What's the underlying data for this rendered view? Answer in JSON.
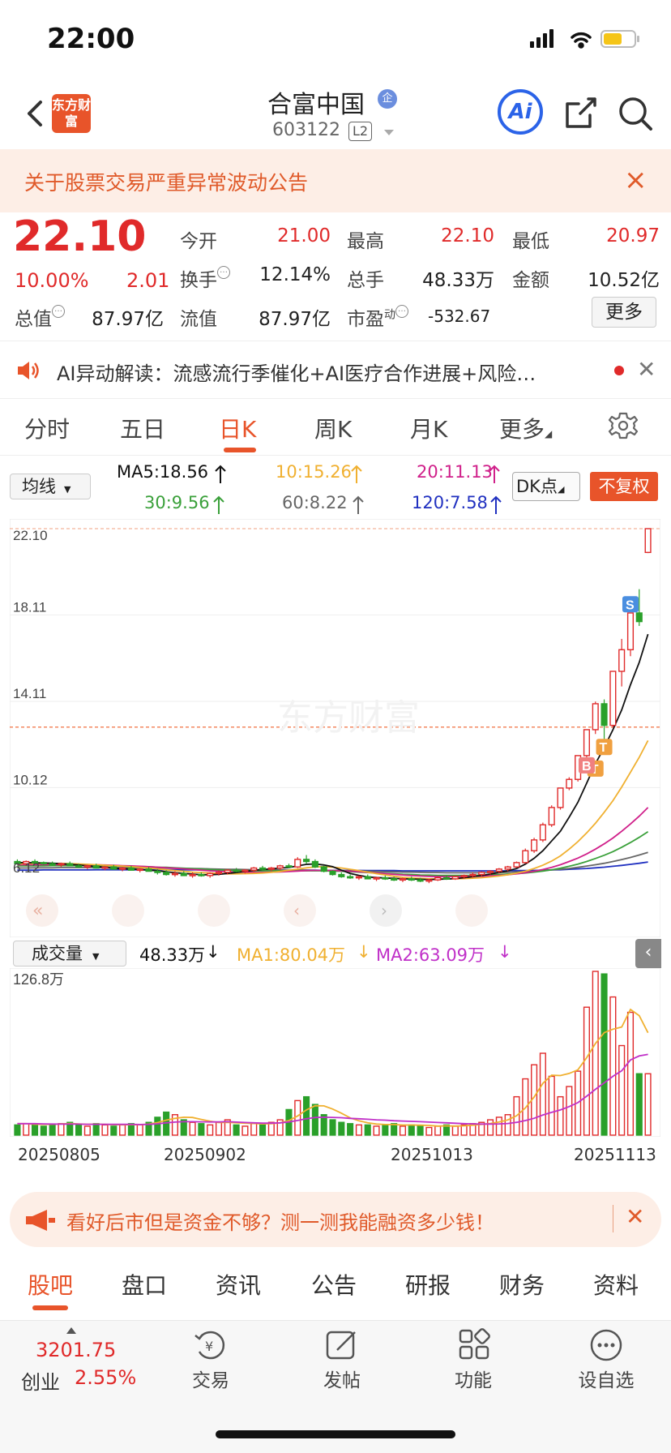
{
  "status": {
    "time": "22:00"
  },
  "header": {
    "logo_text": "东方财富",
    "name": "合富中国",
    "badge": "企",
    "code": "603122",
    "level": "L2",
    "ai_label": "Ai"
  },
  "notice": {
    "text": "关于股票交易严重异常波动公告"
  },
  "quote": {
    "price": "22.10",
    "pct": "10.00%",
    "chg": "2.01",
    "labels": {
      "open": "今开",
      "high": "最高",
      "low": "最低",
      "turnover": "换手",
      "volume": "总手",
      "amount": "金额",
      "total_cap": "总值",
      "float_cap": "流值",
      "pe": "市盈",
      "pe_sup": "动"
    },
    "open": "21.00",
    "high": "22.10",
    "low": "20.97",
    "turnover": "12.14%",
    "volume": "48.33万",
    "amount": "10.52亿",
    "total_cap": "87.97亿",
    "float_cap": "87.97亿",
    "pe": "-532.67",
    "more": "更多"
  },
  "ai_bar": {
    "text": "AI异动解读：流感流行季催化+AI医疗合作进展+风险…"
  },
  "tabs": [
    "分时",
    "五日",
    "日K",
    "周K",
    "月K",
    "更多"
  ],
  "active_tab": "日K",
  "ma": {
    "select": "均线",
    "ma5": "MA5:18.56",
    "ma10": "10:15.26",
    "ma20": "20:11.13",
    "ma30": "30:9.56",
    "ma60": "60:8.22",
    "ma120": "120:7.58",
    "dk": "DK点",
    "fq": "不复权"
  },
  "colors": {
    "up": "#e02a2a",
    "down": "#2aa02a",
    "ma5": "#111111",
    "ma10": "#f0b030",
    "ma20": "#d0208a",
    "ma30": "#3aa03a",
    "ma60": "#666666",
    "ma120": "#2030c0",
    "accent": "#e8542a"
  },
  "chart_data": {
    "type": "candlestick",
    "y_labels": [
      "22.10",
      "18.11",
      "14.11",
      "10.12",
      "6.12"
    ],
    "ylim": [
      6.12,
      22.1
    ],
    "watermark": "东方财富",
    "markers": [
      "S",
      "T",
      "T",
      "B"
    ],
    "candles": [
      [
        6.7,
        6.8,
        6.55,
        6.6
      ],
      [
        6.6,
        6.75,
        6.5,
        6.7
      ],
      [
        6.7,
        6.8,
        6.6,
        6.65
      ],
      [
        6.65,
        6.7,
        6.55,
        6.6
      ],
      [
        6.6,
        6.7,
        6.5,
        6.55
      ],
      [
        6.55,
        6.65,
        6.45,
        6.6
      ],
      [
        6.6,
        6.7,
        6.5,
        6.5
      ],
      [
        6.5,
        6.6,
        6.4,
        6.45
      ],
      [
        6.45,
        6.55,
        6.35,
        6.5
      ],
      [
        6.5,
        6.6,
        6.4,
        6.4
      ],
      [
        6.4,
        6.5,
        6.3,
        6.45
      ],
      [
        6.45,
        6.55,
        6.35,
        6.35
      ],
      [
        6.35,
        6.45,
        6.25,
        6.4
      ],
      [
        6.4,
        6.5,
        6.3,
        6.3
      ],
      [
        6.3,
        6.4,
        6.2,
        6.35
      ],
      [
        6.35,
        6.45,
        6.25,
        6.25
      ],
      [
        6.25,
        6.35,
        6.1,
        6.2
      ],
      [
        6.2,
        6.3,
        6.05,
        6.1
      ],
      [
        6.1,
        6.25,
        6.0,
        6.15
      ],
      [
        6.15,
        6.25,
        6.05,
        6.05
      ],
      [
        6.05,
        6.2,
        5.95,
        6.1
      ],
      [
        6.1,
        6.2,
        6.0,
        6.05
      ],
      [
        6.05,
        6.2,
        5.95,
        6.15
      ],
      [
        6.15,
        6.3,
        6.05,
        6.2
      ],
      [
        6.2,
        6.35,
        6.1,
        6.3
      ],
      [
        6.3,
        6.4,
        6.2,
        6.25
      ],
      [
        6.25,
        6.35,
        6.15,
        6.3
      ],
      [
        6.3,
        6.45,
        6.2,
        6.4
      ],
      [
        6.4,
        6.5,
        6.3,
        6.35
      ],
      [
        6.35,
        6.45,
        6.25,
        6.4
      ],
      [
        6.4,
        6.55,
        6.3,
        6.5
      ],
      [
        6.5,
        6.6,
        6.4,
        6.45
      ],
      [
        6.45,
        6.9,
        6.4,
        6.8
      ],
      [
        6.8,
        7.0,
        6.6,
        6.7
      ],
      [
        6.7,
        6.8,
        6.4,
        6.45
      ],
      [
        6.45,
        6.5,
        6.2,
        6.25
      ],
      [
        6.25,
        6.3,
        6.05,
        6.1
      ],
      [
        6.1,
        6.2,
        5.95,
        6.0
      ],
      [
        6.0,
        6.1,
        5.9,
        5.95
      ],
      [
        5.95,
        6.05,
        5.85,
        6.0
      ],
      [
        6.0,
        6.1,
        5.9,
        5.9
      ],
      [
        5.9,
        6.0,
        5.8,
        5.95
      ],
      [
        5.95,
        6.05,
        5.85,
        5.9
      ],
      [
        5.9,
        6.0,
        5.8,
        5.85
      ],
      [
        5.85,
        5.95,
        5.75,
        5.9
      ],
      [
        5.9,
        6.0,
        5.8,
        5.85
      ],
      [
        5.85,
        5.95,
        5.75,
        5.8
      ],
      [
        5.8,
        5.9,
        5.7,
        5.85
      ],
      [
        5.85,
        6.0,
        5.8,
        5.95
      ],
      [
        5.95,
        6.05,
        5.85,
        5.9
      ],
      [
        5.9,
        6.05,
        5.85,
        6.0
      ],
      [
        6.0,
        6.1,
        5.9,
        6.05
      ],
      [
        6.05,
        6.2,
        5.95,
        6.1
      ],
      [
        6.1,
        6.25,
        6.0,
        6.2
      ],
      [
        6.2,
        6.3,
        6.1,
        6.25
      ],
      [
        6.25,
        6.4,
        6.15,
        6.35
      ],
      [
        6.35,
        6.5,
        6.25,
        6.45
      ],
      [
        6.45,
        6.7,
        6.4,
        6.65
      ],
      [
        6.65,
        7.3,
        6.6,
        7.2
      ],
      [
        7.2,
        7.8,
        7.1,
        7.7
      ],
      [
        7.7,
        8.5,
        7.6,
        8.4
      ],
      [
        8.4,
        9.3,
        8.3,
        9.2
      ],
      [
        9.2,
        10.1,
        9.1,
        10.1
      ],
      [
        10.1,
        10.6,
        10.0,
        10.5
      ],
      [
        10.5,
        11.6,
        10.4,
        11.6
      ],
      [
        11.6,
        12.8,
        11.5,
        12.8
      ],
      [
        12.8,
        14.1,
        12.6,
        14.0
      ],
      [
        14.0,
        14.2,
        12.3,
        13.0
      ],
      [
        13.0,
        15.5,
        12.9,
        15.5
      ],
      [
        15.5,
        17.0,
        14.8,
        16.5
      ],
      [
        16.5,
        18.2,
        16.2,
        18.2
      ],
      [
        18.2,
        19.3,
        17.6,
        17.8
      ],
      [
        21.0,
        22.1,
        20.97,
        22.1
      ]
    ],
    "ma5": [
      6.65,
      6.65,
      6.64,
      6.63,
      6.62,
      6.6,
      6.57,
      6.54,
      6.5,
      6.47,
      6.43,
      6.39,
      6.37,
      6.35,
      6.33,
      6.3,
      6.27,
      6.23,
      6.18,
      6.15,
      6.12,
      6.09,
      6.09,
      6.11,
      6.15,
      6.19,
      6.24,
      6.29,
      6.33,
      6.36,
      6.4,
      6.42,
      6.5,
      6.57,
      6.59,
      6.54,
      6.46,
      6.3,
      6.15,
      6.06,
      5.99,
      5.96,
      5.94,
      5.92,
      5.9,
      5.89,
      5.88,
      5.86,
      5.88,
      5.89,
      5.91,
      5.95,
      6.0,
      6.05,
      6.12,
      6.19,
      6.27,
      6.38,
      6.58,
      6.85,
      7.2,
      7.65,
      8.1,
      8.75,
      9.44,
      10.32,
      11.22,
      11.98,
      12.8,
      13.72,
      14.88,
      15.91,
      17.22
    ],
    "ma10": [
      6.6,
      6.6,
      6.61,
      6.61,
      6.61,
      6.61,
      6.6,
      6.59,
      6.57,
      6.55,
      6.53,
      6.51,
      6.49,
      6.46,
      6.43,
      6.4,
      6.36,
      6.32,
      6.28,
      6.25,
      6.21,
      6.19,
      6.17,
      6.15,
      6.13,
      6.13,
      6.14,
      6.15,
      6.17,
      6.2,
      6.24,
      6.3,
      6.35,
      6.41,
      6.45,
      6.46,
      6.44,
      6.4,
      6.34,
      6.28,
      6.21,
      6.14,
      6.08,
      6.02,
      5.97,
      5.94,
      5.92,
      5.9,
      5.9,
      5.9,
      5.9,
      5.91,
      5.93,
      5.95,
      5.99,
      6.03,
      6.09,
      6.16,
      6.25,
      6.38,
      6.53,
      6.72,
      6.96,
      7.27,
      7.62,
      8.02,
      8.47,
      8.98,
      9.52,
      10.15,
      10.83,
      11.52,
      12.3
    ],
    "ma20": [
      6.55,
      6.55,
      6.55,
      6.56,
      6.56,
      6.56,
      6.56,
      6.56,
      6.56,
      6.55,
      6.54,
      6.53,
      6.51,
      6.5,
      6.48,
      6.46,
      6.44,
      6.41,
      6.39,
      6.36,
      6.33,
      6.3,
      6.27,
      6.25,
      6.23,
      6.22,
      6.21,
      6.2,
      6.2,
      6.21,
      6.22,
      6.24,
      6.26,
      6.28,
      6.29,
      6.29,
      6.28,
      6.27,
      6.25,
      6.23,
      6.2,
      6.17,
      6.14,
      6.11,
      6.08,
      6.05,
      6.03,
      6.01,
      6.0,
      6.0,
      6.0,
      6.0,
      6.01,
      6.02,
      6.04,
      6.06,
      6.09,
      6.13,
      6.18,
      6.25,
      6.33,
      6.43,
      6.55,
      6.7,
      6.86,
      7.05,
      7.27,
      7.52,
      7.79,
      8.1,
      8.44,
      8.8,
      9.2
    ],
    "ma30": [
      6.5,
      6.5,
      6.5,
      6.5,
      6.51,
      6.51,
      6.51,
      6.51,
      6.51,
      6.51,
      6.5,
      6.5,
      6.49,
      6.48,
      6.47,
      6.46,
      6.44,
      6.43,
      6.41,
      6.39,
      6.37,
      6.35,
      6.33,
      6.31,
      6.3,
      6.29,
      6.28,
      6.27,
      6.27,
      6.27,
      6.27,
      6.27,
      6.27,
      6.27,
      6.27,
      6.27,
      6.26,
      6.25,
      6.23,
      6.21,
      6.19,
      6.17,
      6.15,
      6.13,
      6.11,
      6.1,
      6.08,
      6.07,
      6.06,
      6.06,
      6.06,
      6.06,
      6.06,
      6.07,
      6.08,
      6.1,
      6.12,
      6.14,
      6.17,
      6.21,
      6.26,
      6.32,
      6.39,
      6.48,
      6.58,
      6.7,
      6.84,
      6.99,
      7.16,
      7.36,
      7.58,
      7.82,
      8.08
    ],
    "ma60": [
      6.4,
      6.4,
      6.41,
      6.41,
      6.41,
      6.42,
      6.42,
      6.42,
      6.42,
      6.42,
      6.42,
      6.42,
      6.42,
      6.41,
      6.41,
      6.41,
      6.4,
      6.4,
      6.39,
      6.38,
      6.38,
      6.37,
      6.36,
      6.35,
      6.34,
      6.34,
      6.33,
      6.32,
      6.32,
      6.31,
      6.31,
      6.3,
      6.3,
      6.3,
      6.29,
      6.29,
      6.28,
      6.28,
      6.27,
      6.26,
      6.25,
      6.24,
      6.23,
      6.22,
      6.21,
      6.21,
      6.2,
      6.19,
      6.19,
      6.18,
      6.18,
      6.18,
      6.18,
      6.18,
      6.19,
      6.2,
      6.2,
      6.22,
      6.23,
      6.25,
      6.28,
      6.31,
      6.34,
      6.38,
      6.43,
      6.49,
      6.55,
      6.62,
      6.7,
      6.79,
      6.89,
      7.0,
      7.12
    ],
    "ma120": [
      6.3,
      6.3,
      6.3,
      6.31,
      6.31,
      6.31,
      6.31,
      6.31,
      6.31,
      6.32,
      6.32,
      6.32,
      6.32,
      6.32,
      6.32,
      6.32,
      6.32,
      6.32,
      6.32,
      6.32,
      6.31,
      6.31,
      6.31,
      6.31,
      6.31,
      6.31,
      6.3,
      6.3,
      6.3,
      6.3,
      6.3,
      6.3,
      6.3,
      6.3,
      6.3,
      6.29,
      6.29,
      6.29,
      6.29,
      6.29,
      6.28,
      6.28,
      6.28,
      6.28,
      6.27,
      6.27,
      6.27,
      6.27,
      6.27,
      6.27,
      6.27,
      6.27,
      6.27,
      6.27,
      6.27,
      6.27,
      6.27,
      6.28,
      6.28,
      6.29,
      6.3,
      6.31,
      6.32,
      6.34,
      6.36,
      6.38,
      6.41,
      6.44,
      6.48,
      6.52,
      6.57,
      6.62,
      6.68
    ],
    "volume": [
      8,
      9,
      8,
      7,
      8,
      9,
      10,
      8,
      7,
      9,
      8,
      7,
      8,
      9,
      8,
      10,
      14,
      18,
      16,
      12,
      10,
      9,
      8,
      10,
      12,
      8,
      7,
      9,
      8,
      10,
      12,
      20,
      27,
      30,
      24,
      16,
      12,
      10,
      9,
      8,
      8,
      7,
      8,
      9,
      7,
      8,
      7,
      6,
      7,
      8,
      7,
      8,
      9,
      10,
      12,
      14,
      16,
      30,
      44,
      55,
      64,
      46,
      30,
      38,
      50,
      100,
      128,
      126,
      108,
      70,
      96,
      48,
      48
    ],
    "vol_ma1": [
      9,
      9,
      8.5,
      8.4,
      8.5,
      8.8,
      9.1,
      8.8,
      8.5,
      8.6,
      8.4,
      8.2,
      8.1,
      8.2,
      8.2,
      8.6,
      9.8,
      11.7,
      13.1,
      14,
      13.8,
      12.3,
      10.9,
      9.8,
      10,
      9.7,
      9.4,
      9.1,
      8.8,
      9,
      9.6,
      11.4,
      15,
      19.7,
      23,
      22.9,
      20.4,
      17.2,
      13.5,
      11.2,
      9.6,
      8.7,
      8.3,
      8.3,
      7.9,
      7.9,
      7.8,
      7.6,
      7.1,
      7.3,
      7.1,
      7.3,
      7.8,
      8.4,
      9.1,
      10.3,
      11.9,
      15.2,
      21.3,
      29.8,
      40.5,
      46.8,
      46.6,
      48.2,
      51.1,
      60.5,
      71.6,
      80.1,
      82.8,
      84.5,
      98.2,
      93.4,
      80.04
    ],
    "vol_ma2": [
      9,
      9,
      9,
      8.8,
      8.7,
      8.6,
      8.7,
      8.6,
      8.5,
      8.5,
      8.5,
      8.4,
      8.4,
      8.4,
      8.3,
      8.4,
      8.9,
      9.6,
      10.2,
      10.5,
      10.5,
      10.4,
      10.3,
      10.3,
      10.5,
      10.2,
      9.9,
      9.6,
      9.4,
      9.4,
      9.6,
      10.3,
      11.5,
      12.8,
      13.8,
      14,
      13.9,
      13.6,
      13.1,
      12.8,
      12.4,
      12,
      11.7,
      11.3,
      11,
      10.8,
      10.5,
      10.2,
      9.9,
      9.6,
      9.3,
      9,
      8.8,
      8.7,
      8.7,
      8.8,
      9.1,
      10,
      11.4,
      13.2,
      15.8,
      17.8,
      19.7,
      22.3,
      25.4,
      30.4,
      35.8,
      40.9,
      46,
      50.3,
      58.8,
      61.9,
      63.09
    ],
    "vol_ylabel": "126.8万",
    "x_labels": [
      "20250805",
      "20250902",
      "20251013",
      "20251113"
    ]
  },
  "volume_row": {
    "select": "成交量",
    "vol": "48.33万",
    "ma1": "MA1:80.04万",
    "ma2": "MA2:63.09万"
  },
  "ad": {
    "text": "看好后市但是资金不够？测一测我能融资多少钱！"
  },
  "bottom_tabs": [
    "股吧",
    "盘口",
    "资讯",
    "公告",
    "研报",
    "财务",
    "资料"
  ],
  "nav": {
    "index_value": "3201.75",
    "index_name": "创业",
    "index_pct": "2.55%",
    "items": [
      "交易",
      "发帖",
      "功能",
      "设自选"
    ]
  }
}
